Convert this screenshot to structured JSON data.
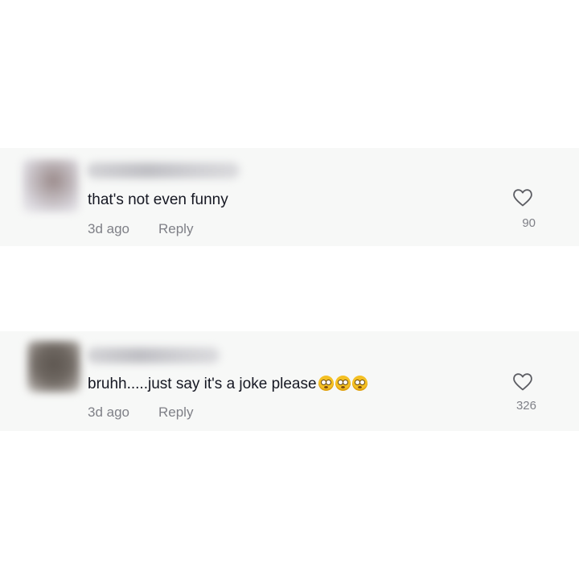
{
  "comments": [
    {
      "text": "that's not even funny",
      "time": "3d ago",
      "reply_label": "Reply",
      "likes": "90",
      "emoji_count": 0
    },
    {
      "text": "bruhh.....just say it's a joke please",
      "time": "3d ago",
      "reply_label": "Reply",
      "likes": "326",
      "emoji": "flushed-face",
      "emoji_count": 3
    }
  ],
  "colors": {
    "comment_bg": "#f7f8f7",
    "text": "#161823",
    "muted": "#7f8087"
  }
}
